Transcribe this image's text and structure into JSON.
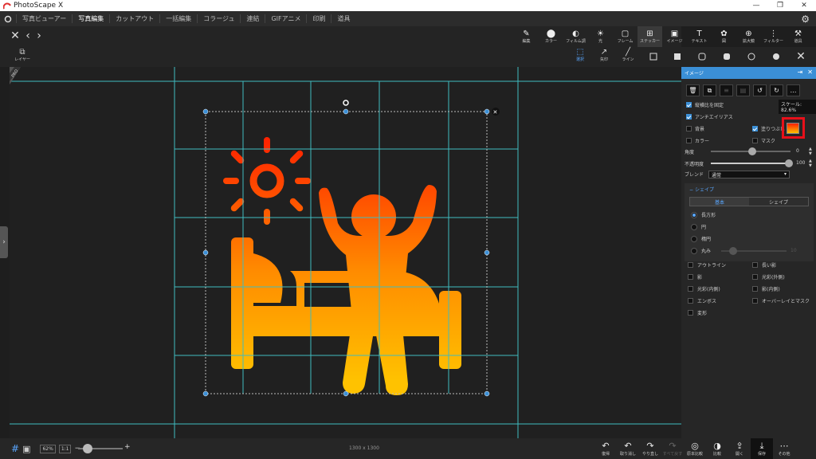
{
  "app": {
    "title": "PhotoScape X"
  },
  "window": {
    "minimize": "—",
    "restore": "❐",
    "close": "✕"
  },
  "menu": {
    "items": [
      "写真ビューアー",
      "写真編集",
      "カットアウト",
      "一括編集",
      "コラージュ",
      "連結",
      "GIFアニメ",
      "印刷",
      "道具"
    ],
    "active_index": 1
  },
  "tools": [
    {
      "icon": "✎",
      "label": "編集"
    },
    {
      "icon": "⬤",
      "label": "カラー"
    },
    {
      "icon": "◐",
      "label": "フィルム調"
    },
    {
      "icon": "☀",
      "label": "光"
    },
    {
      "icon": "▢",
      "label": "フレーム"
    },
    {
      "icon": "⊞",
      "label": "ステッカー"
    },
    {
      "icon": "▣",
      "label": "イメージ"
    },
    {
      "icon": "T",
      "label": "テキスト"
    },
    {
      "icon": "✿",
      "label": "図"
    },
    {
      "icon": "⊕",
      "label": "拡大鏡"
    },
    {
      "icon": "⋮",
      "label": "フィルター"
    },
    {
      "icon": "⚒",
      "label": "道具"
    }
  ],
  "layer_button": "レイヤー",
  "subtools": {
    "select": "選択",
    "arrow": "矢印",
    "line": "ライン"
  },
  "panel": {
    "title": "イメージ",
    "scale_label": "スケール: 82.6%",
    "lock_ratio": "縦横比を固定",
    "antialias": "アンチエイリアス",
    "background": "背景",
    "fill": "塗りつぶし",
    "color": "カラー",
    "mask": "マスク",
    "angle_label": "角度",
    "angle_value": "0",
    "opacity_label": "不透明度",
    "opacity_value": "100",
    "blend_label": "ブレンド",
    "blend_value": "通常",
    "shape_section": "シェイプ",
    "tabs": [
      "基本",
      "シェイプ"
    ],
    "shapes": [
      "長方形",
      "円",
      "楕円",
      "丸み"
    ],
    "roundness_value": "10",
    "effects": [
      "アウトライン",
      "長い影",
      "影",
      "光彩(外側)",
      "光彩(内側)",
      "影(内側)",
      "エンボス",
      "オーバーレイとマスク",
      "変形"
    ]
  },
  "bottom": {
    "zoom_pct": "62%",
    "one_to_one": "1:1",
    "minus": "−",
    "plus": "+",
    "dimensions": "1300 x 1300",
    "tools": [
      {
        "icon": "↶",
        "label": "復帰"
      },
      {
        "icon": "↶",
        "label": "取り消し"
      },
      {
        "icon": "↷",
        "label": "やり直し"
      },
      {
        "icon": "↷",
        "label": "すべて戻す"
      },
      {
        "icon": "◎",
        "label": "原本比較"
      },
      {
        "icon": "◑",
        "label": "比較"
      },
      {
        "icon": "⇪",
        "label": "開く"
      },
      {
        "icon": "⤓",
        "label": "保存"
      },
      {
        "icon": "⋯",
        "label": "その他"
      }
    ]
  },
  "colors": {
    "accent": "#3b8fd6",
    "gradient_top": "#ff2000",
    "gradient_bottom": "#ffc000",
    "guide": "#3fbcc0",
    "highlight": "#e8101a"
  }
}
